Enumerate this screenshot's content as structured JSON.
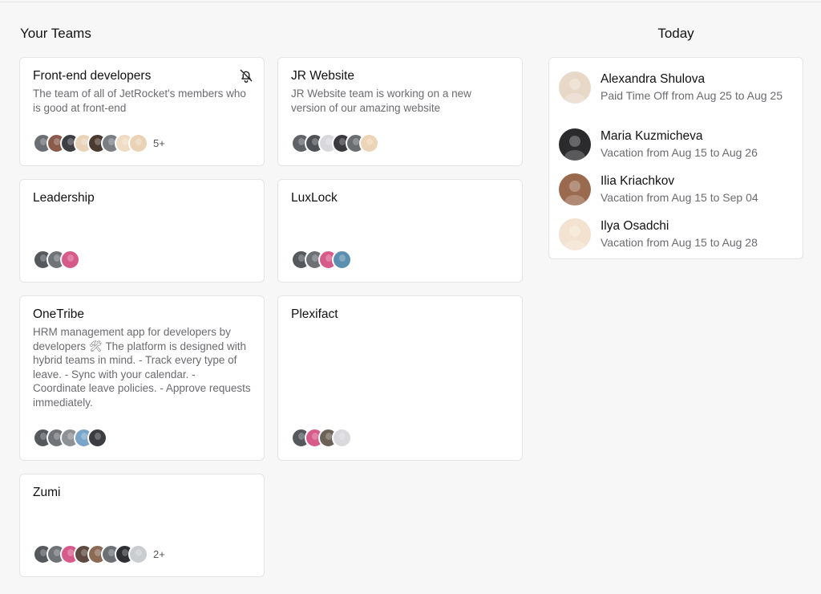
{
  "teams_title": "Your Teams",
  "today_title": "Today",
  "teams": [
    {
      "title": "Front-end developers",
      "desc": "The team of all of JetRocket's members who is good at front-end",
      "more": "5+",
      "avatars": [
        "#6b6f73",
        "#8a5a4a",
        "#3e3f44",
        "#e8d3b8",
        "#4a3a30",
        "#7b7f84",
        "#f0dcc4",
        "#e9d2b5"
      ]
    },
    {
      "title": "JR Website",
      "desc": "JR Website team is working on a new version of our amazing website",
      "more": "",
      "avatars": [
        "#5f6368",
        "#4e5257",
        "#d8d8dc",
        "#3a3a3e",
        "#6a6e72",
        "#ecd4b6"
      ]
    },
    {
      "title": "Leadership",
      "desc": "",
      "more": "",
      "avatars": [
        "#55595e",
        "#707478",
        "#d65a8a"
      ]
    },
    {
      "title": "LuxLock",
      "desc": "",
      "more": "",
      "avatars": [
        "#55595e",
        "#6d7176",
        "#d65a8a",
        "#5a8fb0"
      ]
    },
    {
      "title": "OneTribe",
      "desc": "HRM management app for developers by developers 🛠 The platform is designed with hybrid teams in mind. - Track every type of leave. - Sync with your calendar. - Coordinate leave policies. - Approve requests immediately.",
      "more": "",
      "avatars": [
        "#55595e",
        "#707478",
        "#8e9296",
        "#7aa4c8",
        "#3b3d42"
      ]
    },
    {
      "title": "Plexifact",
      "desc": "",
      "more": "",
      "avatars": [
        "#55595e",
        "#d65a8a",
        "#6d6257",
        "#d9d9de"
      ]
    },
    {
      "title": "Zumi",
      "desc": "",
      "more": "2+",
      "avatars": [
        "#55595e",
        "#707478",
        "#d65a8a",
        "#5e4a40",
        "#8b6b55",
        "#6d7176",
        "#2f3035",
        "#c9ccd0"
      ]
    }
  ],
  "today": [
    {
      "name": "Alexandra Shulova",
      "note": "Paid Time Off from Aug 25 to Aug 25",
      "color": "#e8d8c8"
    },
    {
      "name": "Maria Kuzmicheva",
      "note": "Vacation from Aug 15 to Aug 26",
      "color": "#2b2b2e"
    },
    {
      "name": "Ilia Kriachkov",
      "note": "Vacation from Aug 15 to Sep 04",
      "color": "#9a6a4e"
    },
    {
      "name": "Ilya Osadchi",
      "note": "Vacation from Aug 15 to Aug 28",
      "color": "#f2e2cf"
    }
  ]
}
